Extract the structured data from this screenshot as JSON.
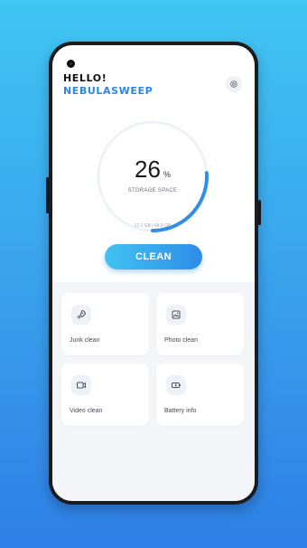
{
  "header": {
    "greeting": "HELLO!",
    "app_name": "NEBULASWEEP",
    "settings_icon": "settings-icon"
  },
  "storage": {
    "percent": 26,
    "percent_text": "26",
    "percent_sign": "%",
    "label": "STORAGE SPACE",
    "amount": "17.1 GB / 64.0 GB"
  },
  "clean_button": {
    "label": "CLEAN"
  },
  "tools": [
    {
      "label": "Junk clean",
      "icon": "rocket-icon"
    },
    {
      "label": "Photo clean",
      "icon": "image-icon"
    },
    {
      "label": "Video clean",
      "icon": "video-icon"
    },
    {
      "label": "Battery info",
      "icon": "battery-icon"
    }
  ],
  "colors": {
    "accent": "#2a86ea",
    "gauge_active": "#2f8fe9",
    "gauge_track": "#eef2f6",
    "background_top": "#3fc6f2",
    "background_bottom": "#2f7fe6"
  }
}
